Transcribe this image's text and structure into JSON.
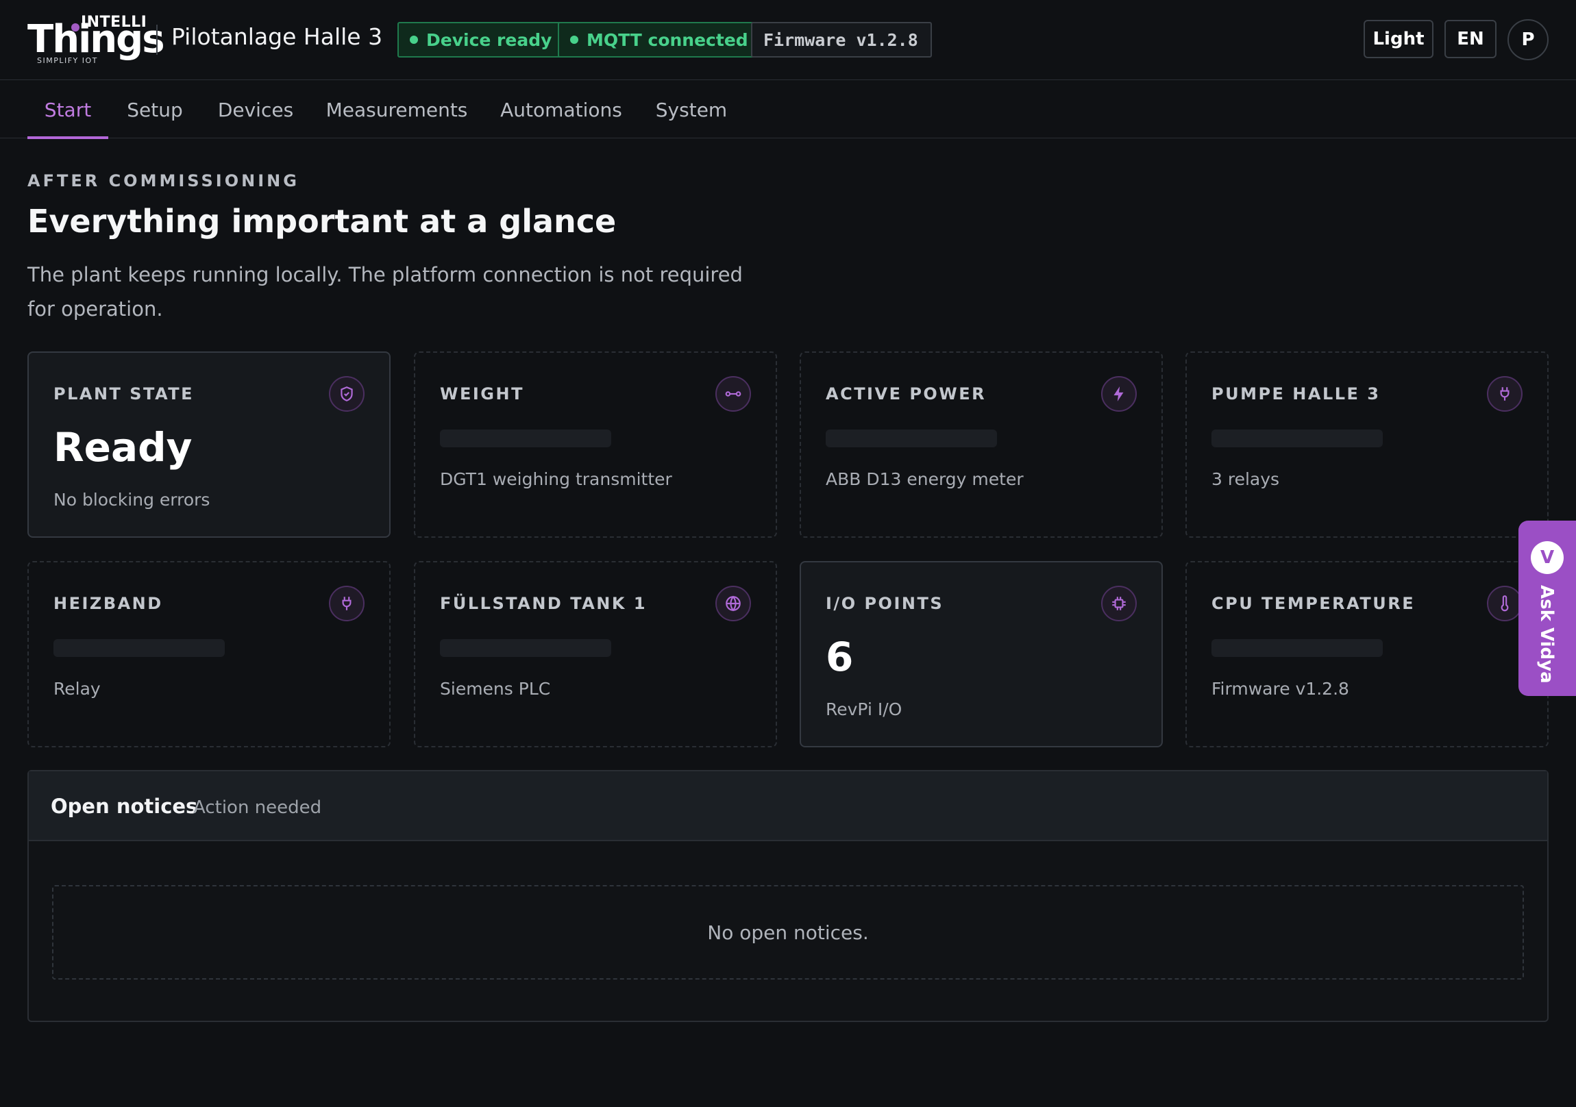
{
  "app": {
    "logo_top": "INTELLI",
    "logo_main": "Things",
    "logo_tagline": "SIMPLIFY IOT",
    "plant_name": "Pilotanlage Halle 3"
  },
  "status": {
    "device": "Device ready",
    "mqtt": "MQTT connected",
    "firmware": "Firmware v1.2.8"
  },
  "header_actions": {
    "theme": "Light",
    "language": "EN",
    "avatar": "P"
  },
  "tabs": [
    {
      "label": "Start",
      "active": true
    },
    {
      "label": "Setup"
    },
    {
      "label": "Devices"
    },
    {
      "label": "Measurements"
    },
    {
      "label": "Automations"
    },
    {
      "label": "System"
    }
  ],
  "hero": {
    "eyebrow": "AFTER COMMISSIONING",
    "title": "Everything important at a glance",
    "subtitle": "The plant keeps running locally. The platform connection is not required for operation."
  },
  "cards": [
    {
      "label": "PLANT STATE",
      "value": "Ready",
      "sub": "No blocking errors",
      "icon": "shield-icon"
    },
    {
      "label": "WEIGHT",
      "sub": "DGT1 weighing transmitter",
      "icon": "scale-icon"
    },
    {
      "label": "ACTIVE POWER",
      "sub": "ABB D13 energy meter",
      "icon": "bolt-icon"
    },
    {
      "label": "PUMPE HALLE 3",
      "sub": "3 relays",
      "icon": "plug-icon"
    },
    {
      "label": "HEIZBAND",
      "sub": "Relay",
      "icon": "plug-icon"
    },
    {
      "label": "FÜLLSTAND TANK 1",
      "sub": "Siemens PLC",
      "icon": "globe-icon"
    },
    {
      "label": "I/O POINTS",
      "value": "6",
      "sub": "RevPi I/O",
      "icon": "chip-icon"
    },
    {
      "label": "CPU TEMPERATURE",
      "sub": "Firmware v1.2.8",
      "icon": "thermometer-icon"
    }
  ],
  "notices": {
    "title": "Open notices",
    "hint": "Action needed",
    "empty": "No open notices."
  },
  "assistant": {
    "badge": "V",
    "label": "Ask Vidya"
  },
  "colors": {
    "accent": "#b367d8",
    "ok": "#48d18b",
    "background": "#0f1114"
  }
}
